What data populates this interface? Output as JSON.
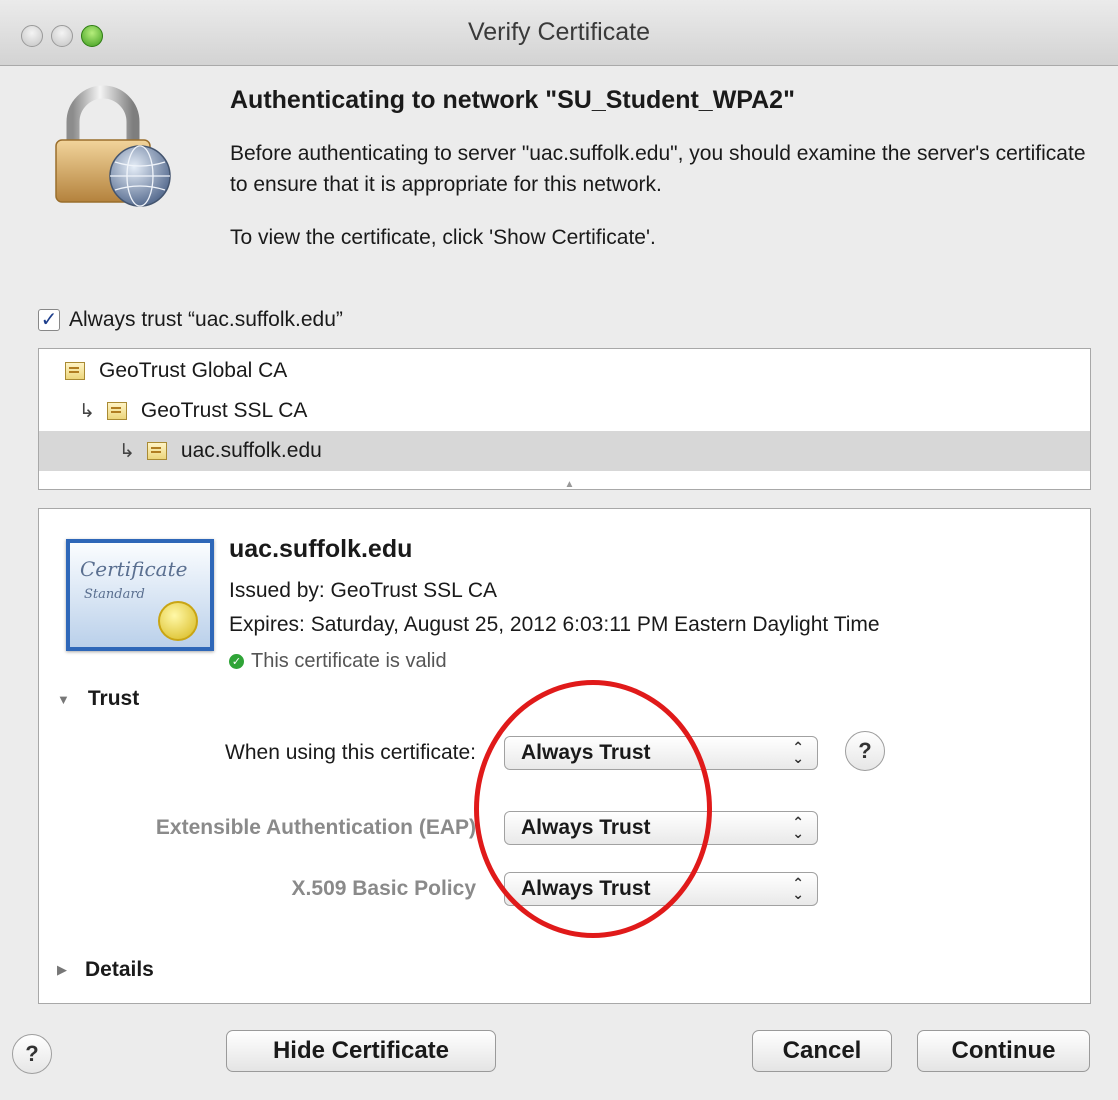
{
  "window": {
    "title": "Verify Certificate"
  },
  "intro": {
    "heading": "Authenticating to network \"SU_Student_WPA2\"",
    "description": "Before authenticating to server \"uac.suffolk.edu\", you should examine the server's certificate to ensure that it is appropriate for this network.",
    "hint": "To view the certificate, click 'Show Certificate'."
  },
  "always_trust": {
    "label": "Always trust “uac.suffolk.edu”",
    "checked": true
  },
  "chain": [
    {
      "label": "GeoTrust Global CA",
      "level": 0,
      "selected": false
    },
    {
      "label": "GeoTrust SSL CA",
      "level": 1,
      "selected": false
    },
    {
      "label": "uac.suffolk.edu",
      "level": 2,
      "selected": true
    }
  ],
  "certificate": {
    "name": "uac.suffolk.edu",
    "issued_by": "Issued by: GeoTrust SSL CA",
    "expires": "Expires: Saturday, August 25, 2012 6:03:11 PM Eastern Daylight Time",
    "status": "This certificate is valid",
    "badge_text_1": "Certificate",
    "badge_text_2": "Standard"
  },
  "trust": {
    "section_label": "Trust",
    "expanded": true,
    "when_using_label": "When using this certificate:",
    "when_using_value": "Always Trust",
    "eap_label": "Extensible Authentication (EAP)",
    "eap_value": "Always Trust",
    "x509_label": "X.509 Basic Policy",
    "x509_value": "Always Trust"
  },
  "details": {
    "section_label": "Details",
    "expanded": false
  },
  "buttons": {
    "hide_certificate": "Hide Certificate",
    "cancel": "Cancel",
    "continue": "Continue",
    "help": "?"
  },
  "icons": {
    "lock": "padlock-globe-icon",
    "check": "checkmark-icon",
    "valid": "green-check-circle-icon",
    "cert_small": "certificate-icon",
    "child_arrow": "↳",
    "disclosure_open": "▼",
    "disclosure_closed": "▶",
    "stepper": "⌃⌄"
  },
  "colors": {
    "highlight": "#e01a1a",
    "selection": "#d7d7d7",
    "valid": "#2fa437"
  }
}
